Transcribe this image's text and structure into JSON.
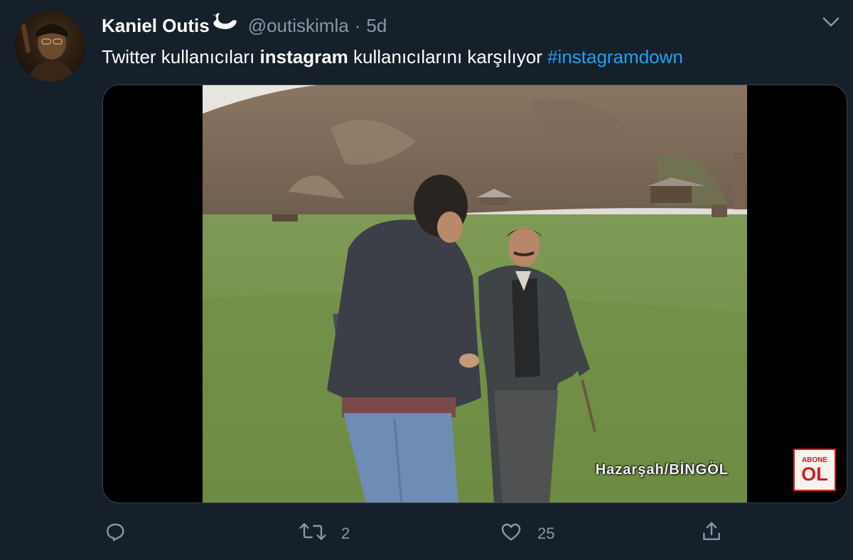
{
  "author": {
    "display_name": "Kaniel Outis",
    "handle": "@outiskimla",
    "separator": "·",
    "time": "5d"
  },
  "tweet": {
    "text_before": "Twitter kullanıcıları ",
    "text_bold": "instagram",
    "text_after": " kullanıcılarını karşılıyor ",
    "hashtag": "#instagramdown"
  },
  "media": {
    "overlay_caption": "Hazarşah/BİNGÖL",
    "badge_top": "ABONE",
    "badge_bottom": "OL"
  },
  "actions": {
    "reply_count": "",
    "retweet_count": "2",
    "like_count": "25"
  },
  "colors": {
    "background": "#15202b",
    "text_primary": "#ffffff",
    "text_secondary": "#8899a6",
    "accent": "#1da1f2",
    "badge_red": "#cc1f1f"
  },
  "icons": [
    "swan-icon",
    "chevron-down-icon",
    "reply-icon",
    "retweet-icon",
    "like-icon",
    "share-icon"
  ]
}
